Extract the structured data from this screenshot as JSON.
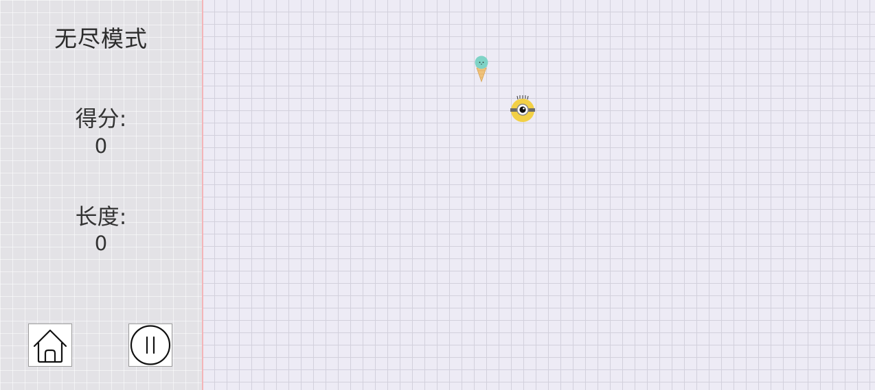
{
  "sidebar": {
    "mode_title": "无尽模式",
    "score_label": "得分:",
    "score_value": "0",
    "length_label": "长度:",
    "length_value": "0"
  },
  "controls": {
    "home_icon": "home-icon",
    "pause_icon": "pause-icon"
  },
  "board": {
    "food_icon": "ice-cream-icon",
    "snake_head_icon": "minion-head-icon"
  },
  "colors": {
    "sidebar_bg": "#e3e2e6",
    "board_bg": "#edebf5",
    "grid_line": "#d2d0dc",
    "board_edge": "#f4b4b8",
    "minion_yellow": "#f2d046",
    "ice_cream_mint": "#7fd3c6",
    "cone": "#f0c27a"
  }
}
